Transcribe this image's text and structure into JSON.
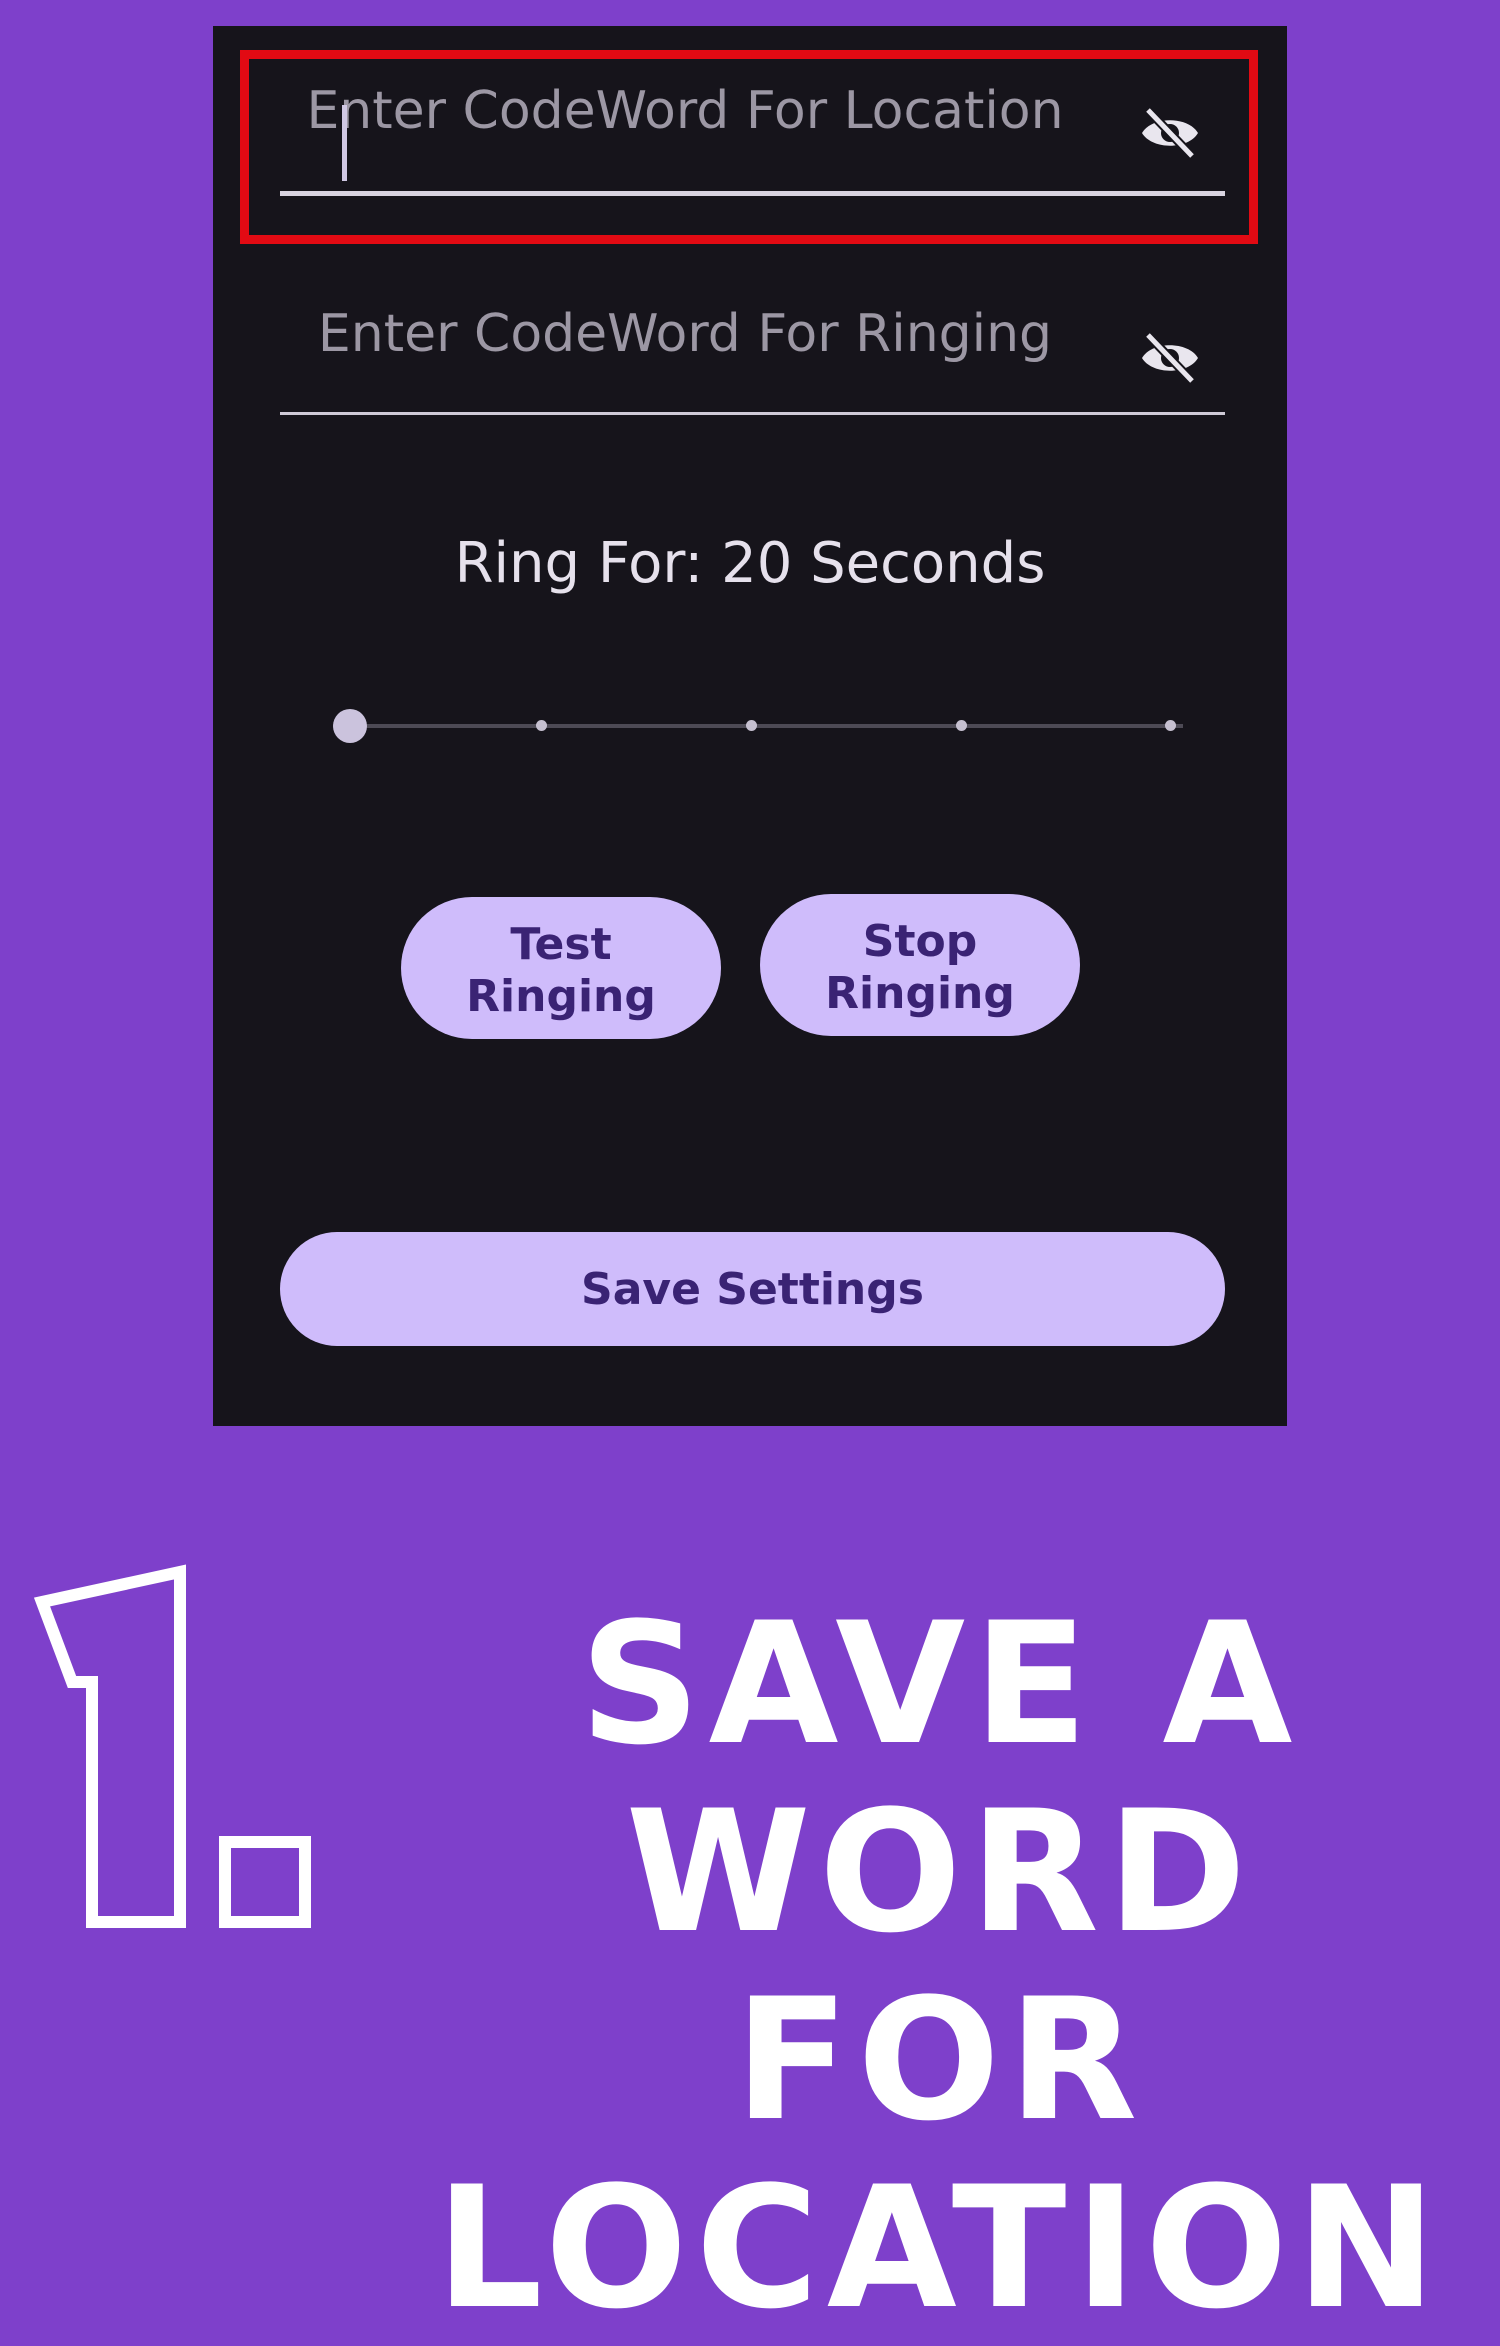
{
  "settings": {
    "location_field": {
      "placeholder": "Enter CodeWord For Location",
      "value": ""
    },
    "ringing_field": {
      "placeholder": "Enter CodeWord For Ringing",
      "value": ""
    },
    "ring_label": "Ring For: 20 Seconds",
    "ring_slider": {
      "value_fraction": 0.0,
      "steps": 5
    },
    "test_button": {
      "line1": "Test",
      "line2": "Ringing"
    },
    "stop_button": {
      "line1": "Stop",
      "line2": "Ringing"
    },
    "save_button": "Save Settings"
  },
  "caption": {
    "number": "1.",
    "line1": "SAVE A WORD",
    "line2": "FOR LOCATION"
  },
  "icons": {
    "visibility_toggle": "eye-off-icon"
  },
  "colors": {
    "background": "#7e40cb",
    "screen": "#16141b",
    "button": "#cfbcfb",
    "button_text": "#3a2374",
    "highlight": "#e20a13"
  }
}
